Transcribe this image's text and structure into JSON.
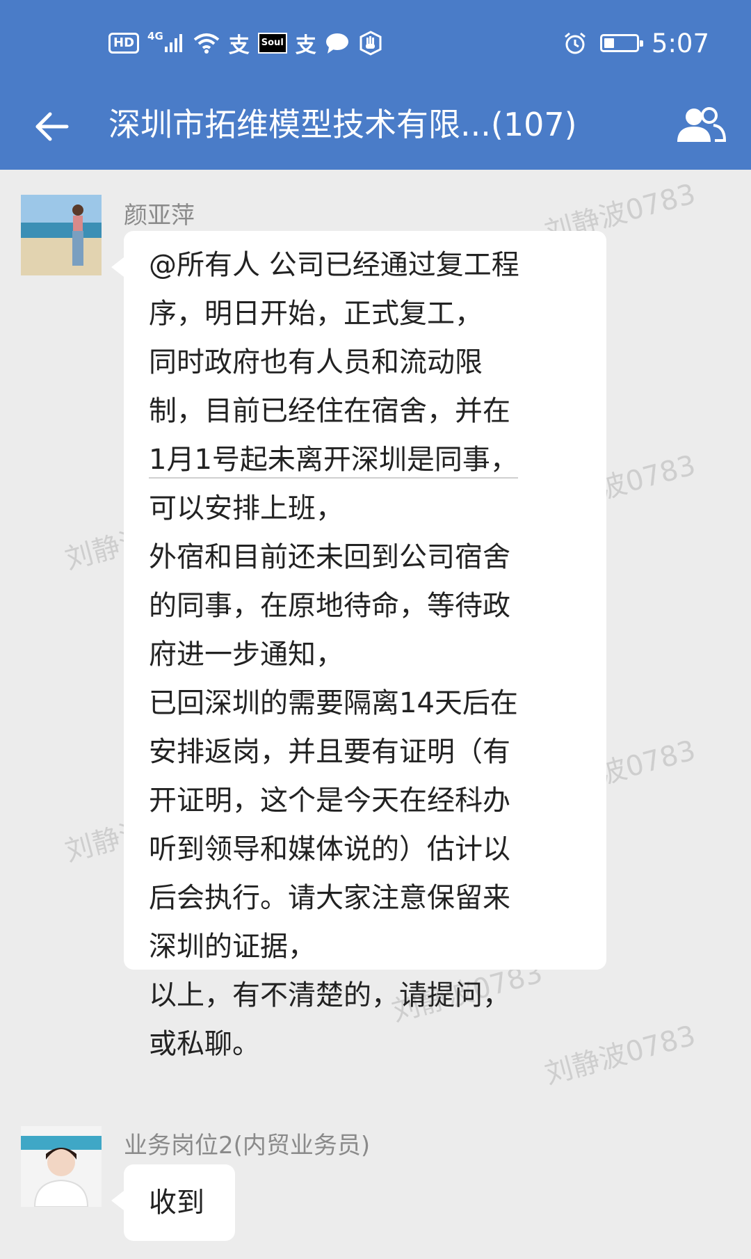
{
  "status_bar": {
    "hd": "HD",
    "network": "4G",
    "app_icon_soul": "Soul",
    "alipay_glyph": "支",
    "time": "5:07",
    "icons": [
      "hd-icon",
      "signal-icon",
      "wifi-icon",
      "alipay-icon",
      "soul-icon",
      "alipay-icon",
      "chat-bubble-icon",
      "hand-icon",
      "alarm-icon",
      "battery-icon"
    ]
  },
  "nav": {
    "title": "深圳市拓维模型技术有限...(107)",
    "back_icon": "back-arrow-icon",
    "members_icon": "group-members-icon"
  },
  "colors": {
    "header_bg": "#4a7cc8",
    "chat_bg": "#ececec",
    "bubble_bg": "#ffffff",
    "name_text": "#8a8a8a"
  },
  "messages": [
    {
      "sender": "颜亚萍",
      "lines": [
        "@所有人  公司已经通过复工程",
        "序，明日开始，正式复工，",
        "同时政府也有人员和流动限",
        "制，目前已经住在宿舍，并在",
        "1月1号起未离开深圳是同事，",
        "可以安排上班，",
        "外宿和目前还未回到公司宿舍",
        "的同事，在原地待命，等待政",
        "府进一步通知，",
        "已回深圳的需要隔离14天后在",
        "安排返岗，并且要有证明（有",
        "开证明，这个是今天在经科办",
        "听到领导和媒体说的）估计以",
        "后会执行。请大家注意保留来",
        "深圳的证据，",
        "以上，有不清楚的，请提问，",
        "或私聊。"
      ]
    },
    {
      "sender": "业务岗位2(内贸业务员)",
      "lines": [
        "收到"
      ]
    }
  ],
  "watermark": "刘静波0783"
}
